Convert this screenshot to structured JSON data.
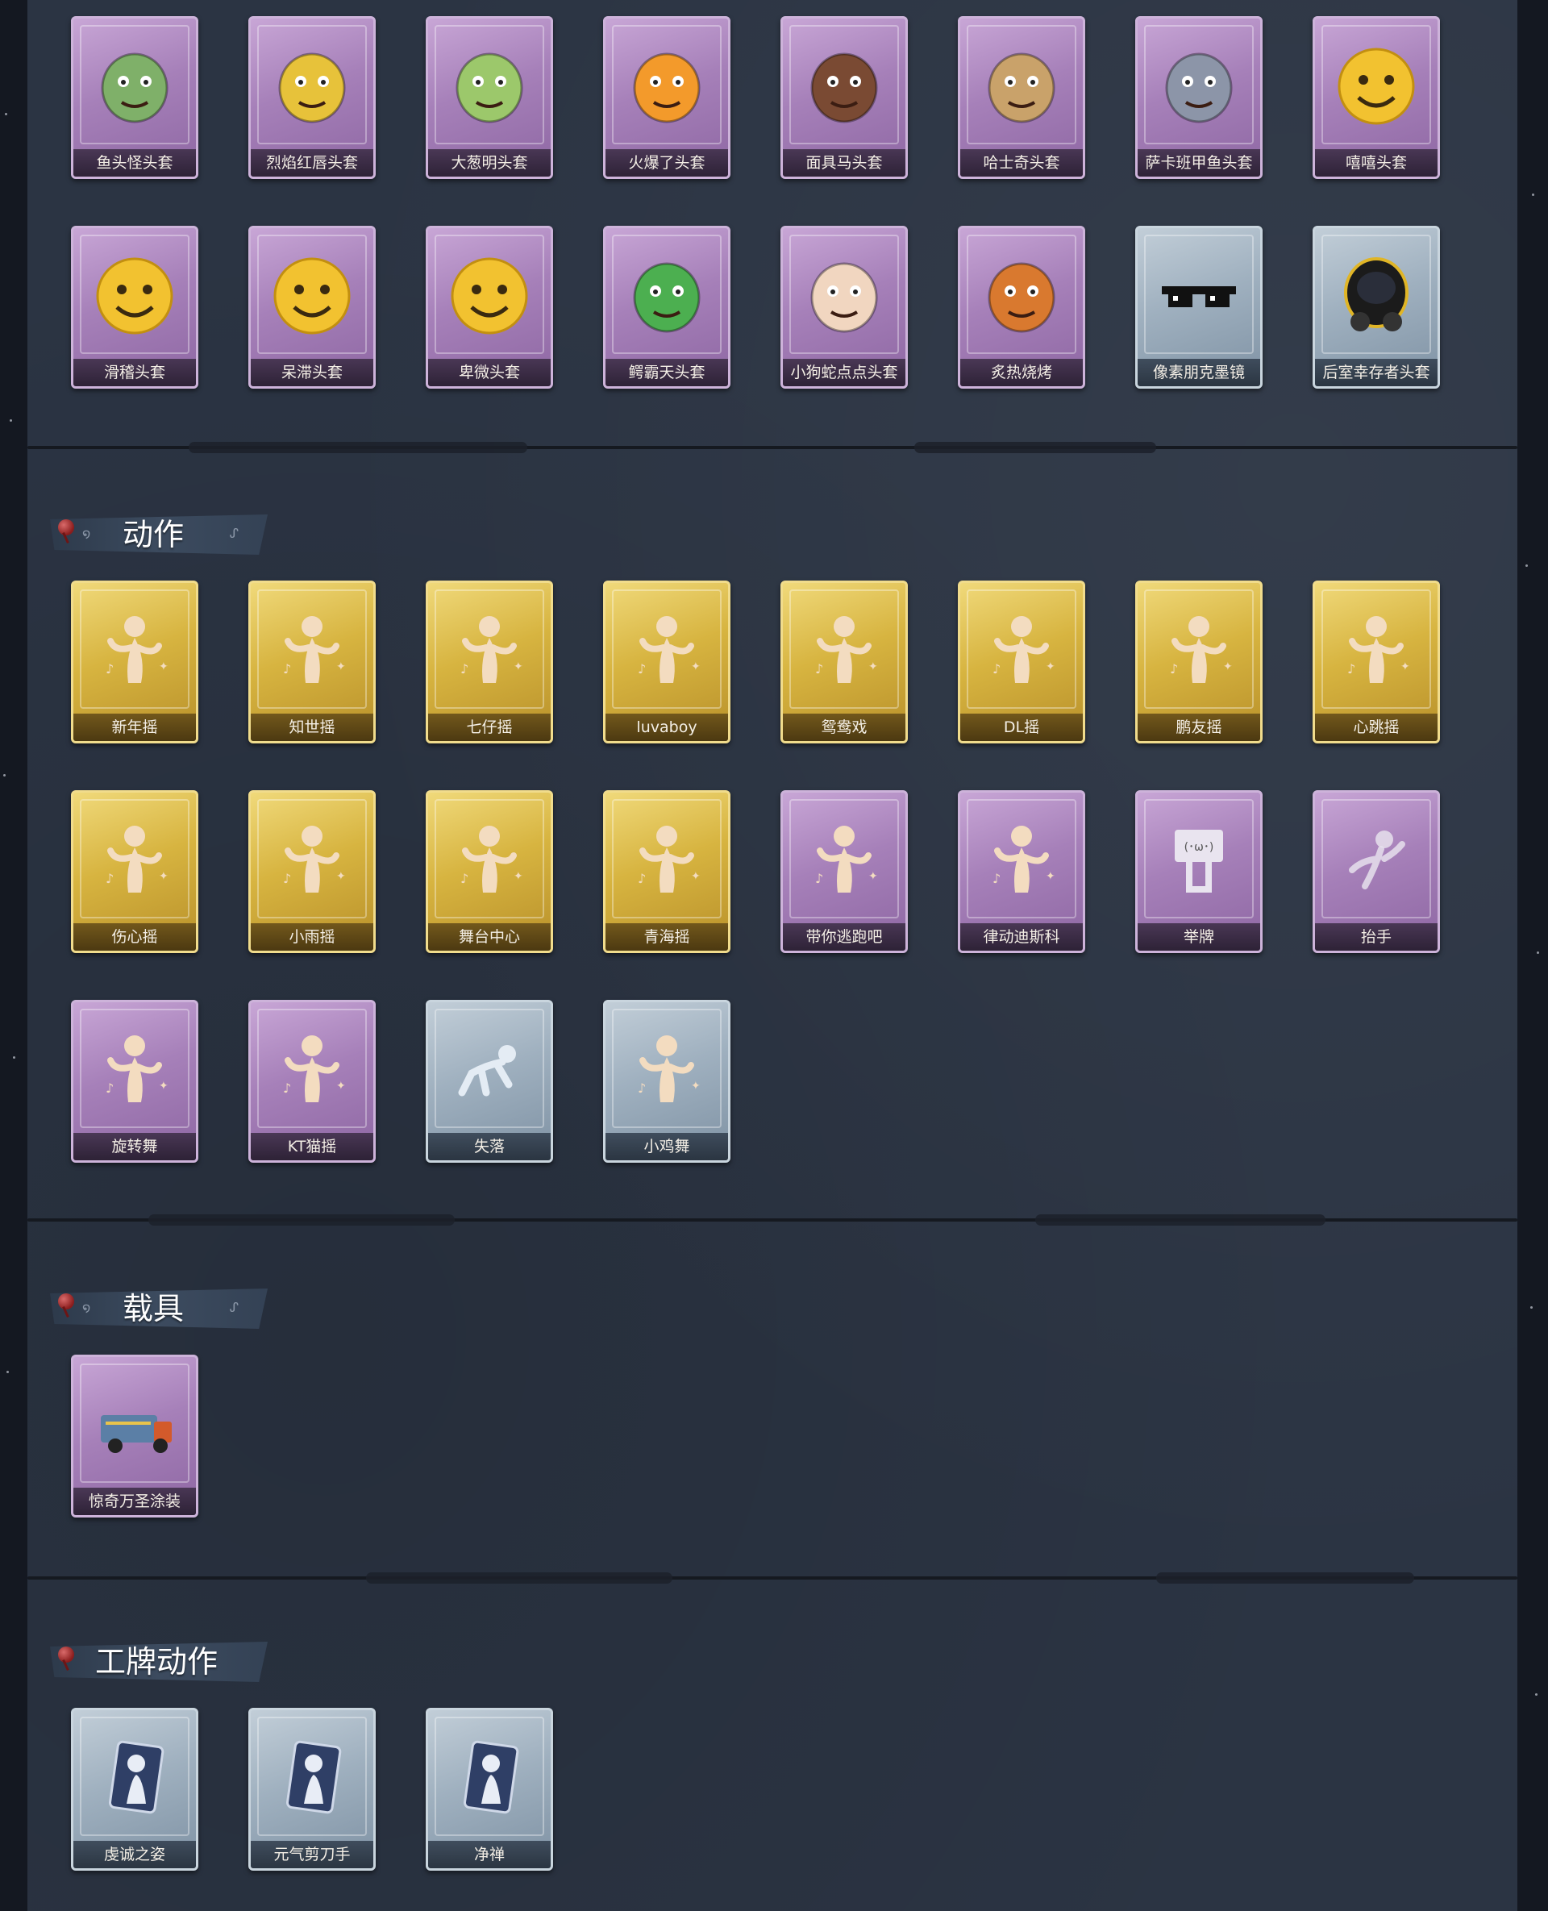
{
  "sections": {
    "action": {
      "title": "动作"
    },
    "vehicle": {
      "title": "载具"
    },
    "badge_action": {
      "title": "工牌动作"
    }
  },
  "headgear": [
    {
      "label": "鱼头怪头套",
      "rarity": "purple",
      "icon": "fish-mask-icon",
      "color": "#7fb069"
    },
    {
      "label": "烈焰红唇头套",
      "rarity": "purple",
      "icon": "yellow-mask-icon",
      "color": "#e7c23a"
    },
    {
      "label": "大葱明头套",
      "rarity": "purple",
      "icon": "scallion-mask-icon",
      "color": "#9cc86b"
    },
    {
      "label": "火爆了头套",
      "rarity": "purple",
      "icon": "flame-mask-icon",
      "color": "#f39a2b"
    },
    {
      "label": "面具马头套",
      "rarity": "purple",
      "icon": "horse-mask-icon",
      "color": "#7a4a33"
    },
    {
      "label": "哈士奇头套",
      "rarity": "purple",
      "icon": "dog-mask-icon",
      "color": "#c9a26a"
    },
    {
      "label": "萨卡班甲鱼头套",
      "rarity": "purple",
      "icon": "fish-head-icon",
      "color": "#8c95a8"
    },
    {
      "label": "嘻嘻头套",
      "rarity": "purple",
      "icon": "grin-emoji-icon",
      "color": "#f2c230"
    },
    {
      "label": "滑稽头套",
      "rarity": "purple",
      "icon": "smile-emoji-icon",
      "color": "#f2c230"
    },
    {
      "label": "呆滞头套",
      "rarity": "purple",
      "icon": "stare-emoji-icon",
      "color": "#f2c230"
    },
    {
      "label": "卑微头套",
      "rarity": "purple",
      "icon": "worried-emoji-icon",
      "color": "#f2c230"
    },
    {
      "label": "鳄霸天头套",
      "rarity": "purple",
      "icon": "crocodile-mask-icon",
      "color": "#4caf50"
    },
    {
      "label": "小狗蛇点点头套",
      "rarity": "purple",
      "icon": "snake-mask-icon",
      "color": "#f1d6c0"
    },
    {
      "label": "炙热烧烤",
      "rarity": "purple",
      "icon": "bbq-mask-icon",
      "color": "#d9792f"
    },
    {
      "label": "像素朋克墨镜",
      "rarity": "blue",
      "icon": "pixel-glasses-icon",
      "color": "#111111"
    },
    {
      "label": "后室幸存者头套",
      "rarity": "blue",
      "icon": "gas-mask-icon",
      "color": "#1d1d1d"
    }
  ],
  "actions": [
    {
      "label": "新年摇",
      "rarity": "gold",
      "icon": "dance-figure-icon"
    },
    {
      "label": "知世摇",
      "rarity": "gold",
      "icon": "dance-figure-icon"
    },
    {
      "label": "七仔摇",
      "rarity": "gold",
      "icon": "dance-figure-icon"
    },
    {
      "label": "luvaboy",
      "rarity": "gold",
      "icon": "dance-figure-icon"
    },
    {
      "label": "鸳鸯戏",
      "rarity": "gold",
      "icon": "dance-figure-icon"
    },
    {
      "label": "DL摇",
      "rarity": "gold",
      "icon": "dance-figure-icon"
    },
    {
      "label": "鹏友摇",
      "rarity": "gold",
      "icon": "dance-figure-icon"
    },
    {
      "label": "心跳摇",
      "rarity": "gold",
      "icon": "dance-figure-icon"
    },
    {
      "label": "伤心摇",
      "rarity": "gold",
      "icon": "dance-figure-icon"
    },
    {
      "label": "小雨摇",
      "rarity": "gold",
      "icon": "dance-figure-icon"
    },
    {
      "label": "舞台中心",
      "rarity": "gold",
      "icon": "dance-figure-icon"
    },
    {
      "label": "青海摇",
      "rarity": "gold",
      "icon": "dance-figure-icon"
    },
    {
      "label": "带你逃跑吧",
      "rarity": "purple",
      "icon": "dance-figure-icon"
    },
    {
      "label": "律动迪斯科",
      "rarity": "purple",
      "icon": "dance-figure-icon"
    },
    {
      "label": "举牌",
      "rarity": "purple",
      "icon": "sign-figure-icon"
    },
    {
      "label": "抬手",
      "rarity": "purple",
      "icon": "raise-hand-figure-icon"
    },
    {
      "label": "旋转舞",
      "rarity": "purple",
      "icon": "dance-figure-icon"
    },
    {
      "label": "KT猫摇",
      "rarity": "purple",
      "icon": "dance-figure-icon"
    },
    {
      "label": "失落",
      "rarity": "blue",
      "icon": "crawl-figure-icon"
    },
    {
      "label": "小鸡舞",
      "rarity": "blue",
      "icon": "dance-figure-icon"
    }
  ],
  "vehicles": [
    {
      "label": "惊奇万圣涂装",
      "rarity": "purple",
      "icon": "truck-icon"
    }
  ],
  "badge_actions": [
    {
      "label": "虔诚之姿",
      "rarity": "blue",
      "icon": "badge-figure-icon"
    },
    {
      "label": "元气剪刀手",
      "rarity": "blue",
      "icon": "badge-figure-icon"
    },
    {
      "label": "净禅",
      "rarity": "blue",
      "icon": "badge-figure-icon"
    }
  ]
}
